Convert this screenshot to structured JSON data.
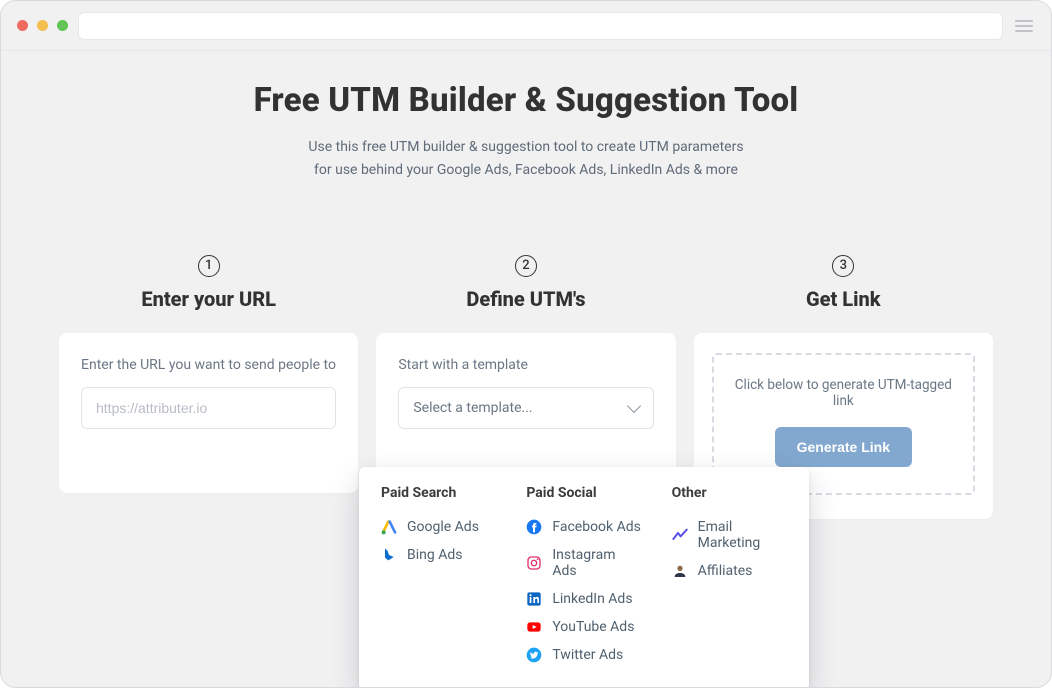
{
  "header": {
    "title": "Free UTM Builder & Suggestion Tool",
    "subtitle_line1": "Use this free UTM builder & suggestion tool to create UTM parameters",
    "subtitle_line2": "for use behind your Google Ads, Facebook Ads, LinkedIn Ads & more"
  },
  "steps": {
    "one": {
      "num": "1",
      "title": "Enter your URL"
    },
    "two": {
      "num": "2",
      "title": "Define UTM's"
    },
    "three": {
      "num": "3",
      "title": "Get Link"
    }
  },
  "step1": {
    "label": "Enter the URL you want to send people to",
    "placeholder": "https://attributer.io"
  },
  "step2": {
    "label": "Start with a template",
    "select_placeholder": "Select a template..."
  },
  "step3": {
    "prompt": "Click below to generate UTM-tagged link",
    "button": "Generate Link"
  },
  "dropdown": {
    "groups": [
      {
        "title": "Paid Search",
        "items": [
          {
            "icon": "google-ads-icon",
            "label": "Google Ads"
          },
          {
            "icon": "bing-ads-icon",
            "label": "Bing Ads"
          }
        ]
      },
      {
        "title": "Paid Social",
        "items": [
          {
            "icon": "facebook-icon",
            "label": "Facebook Ads"
          },
          {
            "icon": "instagram-icon",
            "label": "Instagram Ads"
          },
          {
            "icon": "linkedin-icon",
            "label": "LinkedIn Ads"
          },
          {
            "icon": "youtube-icon",
            "label": "YouTube Ads"
          },
          {
            "icon": "twitter-icon",
            "label": "Twitter Ads"
          }
        ]
      },
      {
        "title": "Other",
        "items": [
          {
            "icon": "email-icon",
            "label": "Email Marketing"
          },
          {
            "icon": "affiliate-icon",
            "label": "Affiliates"
          }
        ]
      }
    ]
  }
}
